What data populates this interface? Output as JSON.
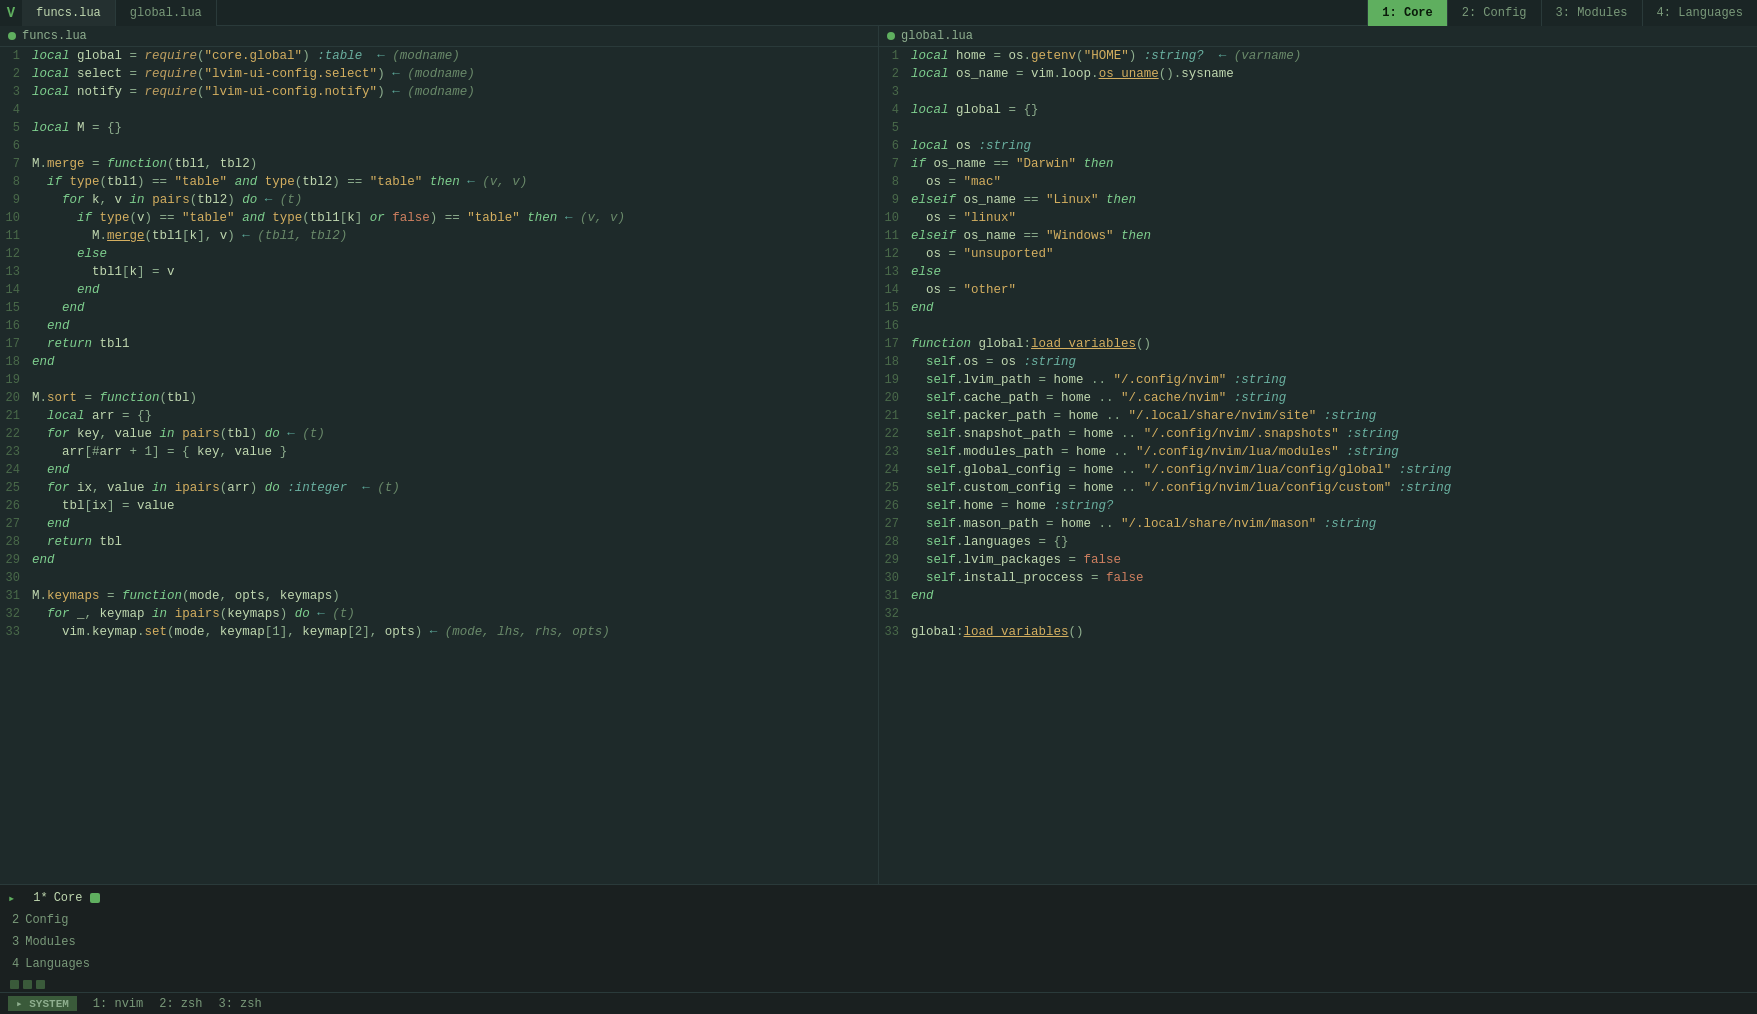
{
  "tabs": {
    "vim_logo": "V",
    "file_tabs": [
      {
        "label": "funcs.lua",
        "active": true
      },
      {
        "label": "global.lua",
        "active": false
      }
    ],
    "window_tabs": [
      {
        "label": "1: Core",
        "active": true
      },
      {
        "label": "2: Config",
        "active": false
      },
      {
        "label": "3: Modules",
        "active": false
      },
      {
        "label": "4: Languages",
        "active": false
      }
    ]
  },
  "pane_left": {
    "title": "funcs.lua",
    "lines": [
      {
        "num": "1",
        "raw": "local global = require(\"core.global\") :table  ← (modname)"
      },
      {
        "num": "2",
        "raw": "local select = require(\"lvim-ui-config.select\") ← (modname)"
      },
      {
        "num": "3",
        "raw": "local notify = require(\"lvim-ui-config.notify\") ← (modname)"
      },
      {
        "num": "4",
        "raw": ""
      },
      {
        "num": "5",
        "raw": "local M = {}"
      },
      {
        "num": "6",
        "raw": ""
      },
      {
        "num": "7",
        "raw": "M.merge = function(tbl1, tbl2)"
      },
      {
        "num": "8",
        "raw": "  if type(tbl1) == \"table\" and type(tbl2) == \"table\" then ← (v, v)"
      },
      {
        "num": "9",
        "raw": "    for k, v in pairs(tbl2) do ← (t)"
      },
      {
        "num": "10",
        "raw": "      if type(v) == \"table\" and type(tbl1[k] or false) == \"table\" then ← (v, v)"
      },
      {
        "num": "11",
        "raw": "        M.merge(tbl1[k], v) ← (tbl1, tbl2)"
      },
      {
        "num": "12",
        "raw": "      else"
      },
      {
        "num": "13",
        "raw": "        tbl1[k] = v"
      },
      {
        "num": "14",
        "raw": "      end"
      },
      {
        "num": "15",
        "raw": "    end"
      },
      {
        "num": "16",
        "raw": "  end"
      },
      {
        "num": "17",
        "raw": "  return tbl1"
      },
      {
        "num": "18",
        "raw": "end"
      },
      {
        "num": "19",
        "raw": ""
      },
      {
        "num": "20",
        "raw": "M.sort = function(tbl)"
      },
      {
        "num": "21",
        "raw": "  local arr = {}"
      },
      {
        "num": "22",
        "raw": "  for key, value in pairs(tbl) do ← (t)"
      },
      {
        "num": "23",
        "raw": "    arr[#arr + 1] = { key, value }"
      },
      {
        "num": "24",
        "raw": "  end"
      },
      {
        "num": "25",
        "raw": "  for ix, value in ipairs(arr) do :integer  ← (t)"
      },
      {
        "num": "26",
        "raw": "    tbl[ix] = value"
      },
      {
        "num": "27",
        "raw": "  end"
      },
      {
        "num": "28",
        "raw": "  return tbl"
      },
      {
        "num": "29",
        "raw": "end"
      },
      {
        "num": "30",
        "raw": ""
      },
      {
        "num": "31",
        "raw": "M.keymaps = function(mode, opts, keymaps)"
      },
      {
        "num": "32",
        "raw": "  for _, keymap in ipairs(keymaps) do ← (t)"
      },
      {
        "num": "33",
        "raw": "    vim.keymap.set(mode, keymap[1], keymap[2], opts) ← (mode, lhs, rhs, opts)"
      }
    ]
  },
  "pane_right": {
    "title": "global.lua",
    "lines": [
      {
        "num": "1",
        "raw": "local home = os.getenv(\"HOME\") :string?  ← (varname)"
      },
      {
        "num": "2",
        "raw": "local os_name = vim.loop.os_uname().sysname"
      },
      {
        "num": "3",
        "raw": ""
      },
      {
        "num": "4",
        "raw": "local global = {}"
      },
      {
        "num": "5",
        "raw": ""
      },
      {
        "num": "6",
        "raw": "local os :string"
      },
      {
        "num": "7",
        "raw": "if os_name == \"Darwin\" then"
      },
      {
        "num": "8",
        "raw": "  os = \"mac\""
      },
      {
        "num": "9",
        "raw": "elseif os_name == \"Linux\" then"
      },
      {
        "num": "10",
        "raw": "  os = \"linux\""
      },
      {
        "num": "11",
        "raw": "elseif os_name == \"Windows\" then"
      },
      {
        "num": "12",
        "raw": "  os = \"unsuported\""
      },
      {
        "num": "13",
        "raw": "else"
      },
      {
        "num": "14",
        "raw": "  os = \"other\""
      },
      {
        "num": "15",
        "raw": "end"
      },
      {
        "num": "16",
        "raw": ""
      },
      {
        "num": "17",
        "raw": "function global:load_variables()"
      },
      {
        "num": "18",
        "raw": "  self.os = os :string"
      },
      {
        "num": "19",
        "raw": "  self.lvim_path = home .. \"/.config/nvim\" :string"
      },
      {
        "num": "20",
        "raw": "  self.cache_path = home .. \"/.cache/nvim\" :string"
      },
      {
        "num": "21",
        "raw": "  self.packer_path = home .. \"/.local/share/nvim/site\" :string"
      },
      {
        "num": "22",
        "raw": "  self.snapshot_path = home .. \"/.config/nvim/.snapshots\" :string"
      },
      {
        "num": "23",
        "raw": "  self.modules_path = home .. \"/.config/nvim/lua/modules\" :string"
      },
      {
        "num": "24",
        "raw": "  self.global_config = home .. \"/.config/nvim/lua/config/global\" :string"
      },
      {
        "num": "25",
        "raw": "  self.custom_config = home .. \"/.config/nvim/lua/config/custom\" :string"
      },
      {
        "num": "26",
        "raw": "  self.home = home :string?"
      },
      {
        "num": "27",
        "raw": "  self.mason_path = home .. \"/.local/share/nvim/mason\" :string"
      },
      {
        "num": "28",
        "raw": "  self.languages = {}"
      },
      {
        "num": "29",
        "raw": "  self.lvim_packages = false"
      },
      {
        "num": "30",
        "raw": "  self.install_proccess = false"
      },
      {
        "num": "31",
        "raw": "end"
      },
      {
        "num": "32",
        "raw": ""
      },
      {
        "num": "33",
        "raw": "global:load_variables()"
      }
    ]
  },
  "buffer_list": [
    {
      "num": "1",
      "name": "Core",
      "active": true,
      "indicator": "1*",
      "modified": true
    },
    {
      "num": "2",
      "name": "Config",
      "active": false
    },
    {
      "num": "3",
      "name": "Modules",
      "active": false
    },
    {
      "num": "4",
      "name": "Languages",
      "active": false
    }
  ],
  "terminal": {
    "dots": 3,
    "tabs": [
      {
        "label": "▸ SYSTEM",
        "active": true
      },
      {
        "label": "1: nvim",
        "active": false
      },
      {
        "label": "2: zsh",
        "active": false
      },
      {
        "label": "3: zsh",
        "active": false
      }
    ]
  }
}
